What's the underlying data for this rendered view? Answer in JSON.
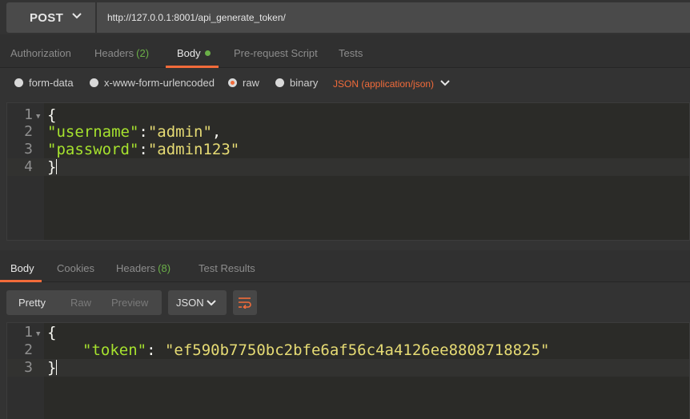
{
  "request": {
    "method": "POST",
    "url": "http://127.0.0.1:8001/api_generate_token/"
  },
  "request_tabs": {
    "authorization": "Authorization",
    "headers": "Headers",
    "headers_count": "(2)",
    "body": "Body",
    "prerequest": "Pre-request Script",
    "tests": "Tests",
    "active": "Body"
  },
  "body_types": {
    "form_data": "form-data",
    "urlencoded": "x-www-form-urlencoded",
    "raw": "raw",
    "binary": "binary",
    "selected": "raw",
    "content_type": "JSON (application/json)"
  },
  "request_editor": {
    "lines": [
      {
        "num": "1",
        "brace": "{"
      },
      {
        "num": "2",
        "key": "\"username\"",
        "colon": ":",
        "value": "\"admin\"",
        "trail": ","
      },
      {
        "num": "3",
        "key": "\"password\"",
        "colon": ":",
        "value": "\"admin123\""
      },
      {
        "num": "4",
        "brace": "}"
      }
    ]
  },
  "response_tabs": {
    "body": "Body",
    "cookies": "Cookies",
    "headers": "Headers",
    "headers_count": "(8)",
    "test_results": "Test Results",
    "active": "Body"
  },
  "response_toolbar": {
    "pretty": "Pretty",
    "raw": "Raw",
    "preview": "Preview",
    "format": "JSON",
    "selected_view": "Pretty"
  },
  "response_editor": {
    "lines": [
      {
        "num": "1",
        "brace": "{"
      },
      {
        "num": "2",
        "key": "\"token\"",
        "colon": ": ",
        "value": "\"ef590b7750bc2bfe6af56c4a4126ee8808718825\""
      },
      {
        "num": "3",
        "brace": "}"
      }
    ]
  },
  "colors": {
    "accent": "#f26b3a",
    "count_green": "#6bb048",
    "json_key": "#a6e22e",
    "json_string": "#e6db74"
  },
  "icons": {
    "method_dropdown": "chevron-down-icon",
    "content_type_dropdown": "chevron-down-icon",
    "format_dropdown": "chevron-down-icon",
    "wrap": "wrap-lines-icon"
  }
}
